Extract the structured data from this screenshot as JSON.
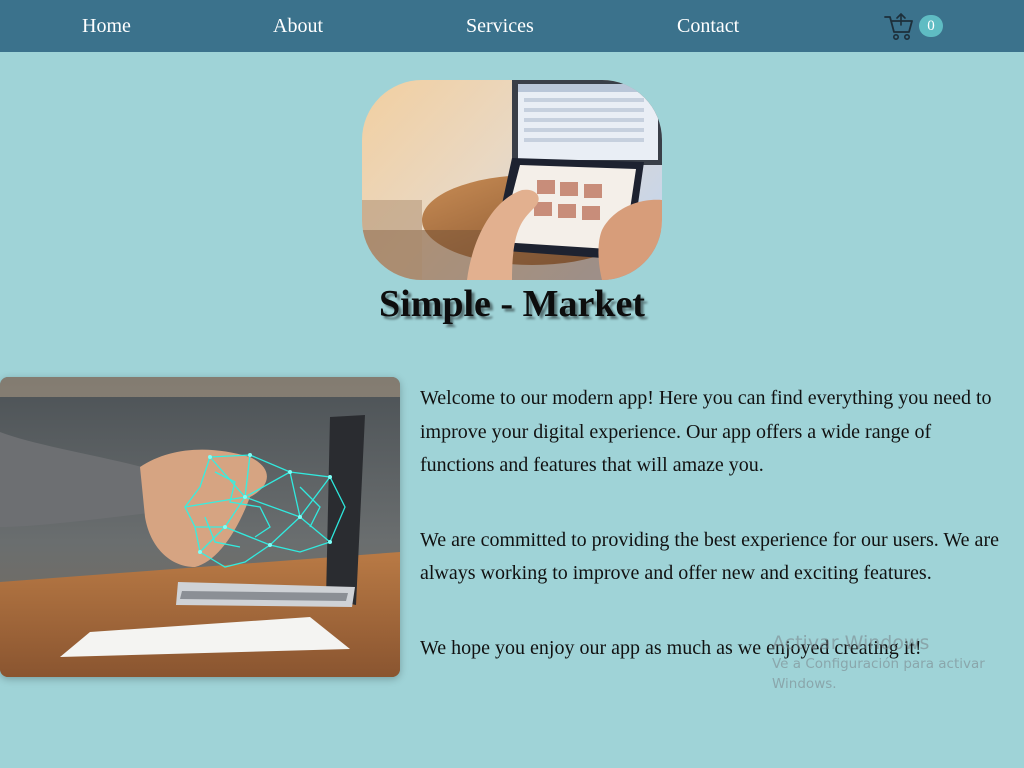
{
  "nav": {
    "home": "Home",
    "about": "About",
    "services": "Services",
    "contact": "Contact"
  },
  "cart": {
    "icon": "shopping-cart-icon",
    "count": "0"
  },
  "hero": {
    "title": "Simple - Market",
    "image": "hands-holding-tablet-photo"
  },
  "feature": {
    "image": "handshake-with-laptop-photo"
  },
  "content": {
    "p1": "Welcome to our modern app! Here you can find everything you need to improve your digital experience. Our app offers a wide range of functions and features that will amaze you.",
    "p2": "We are committed to providing the best experience for our users. We are always working to improve and offer new and exciting features.",
    "p3": "We hope you enjoy our app as much as we enjoyed creating it!"
  },
  "watermark": {
    "title": "Activar Windows",
    "subtitle": "Ve a Configuración para activar Windows."
  },
  "colors": {
    "background": "#9fd3d7",
    "navbar": "#3b728c",
    "badge": "#5fbcc3"
  }
}
